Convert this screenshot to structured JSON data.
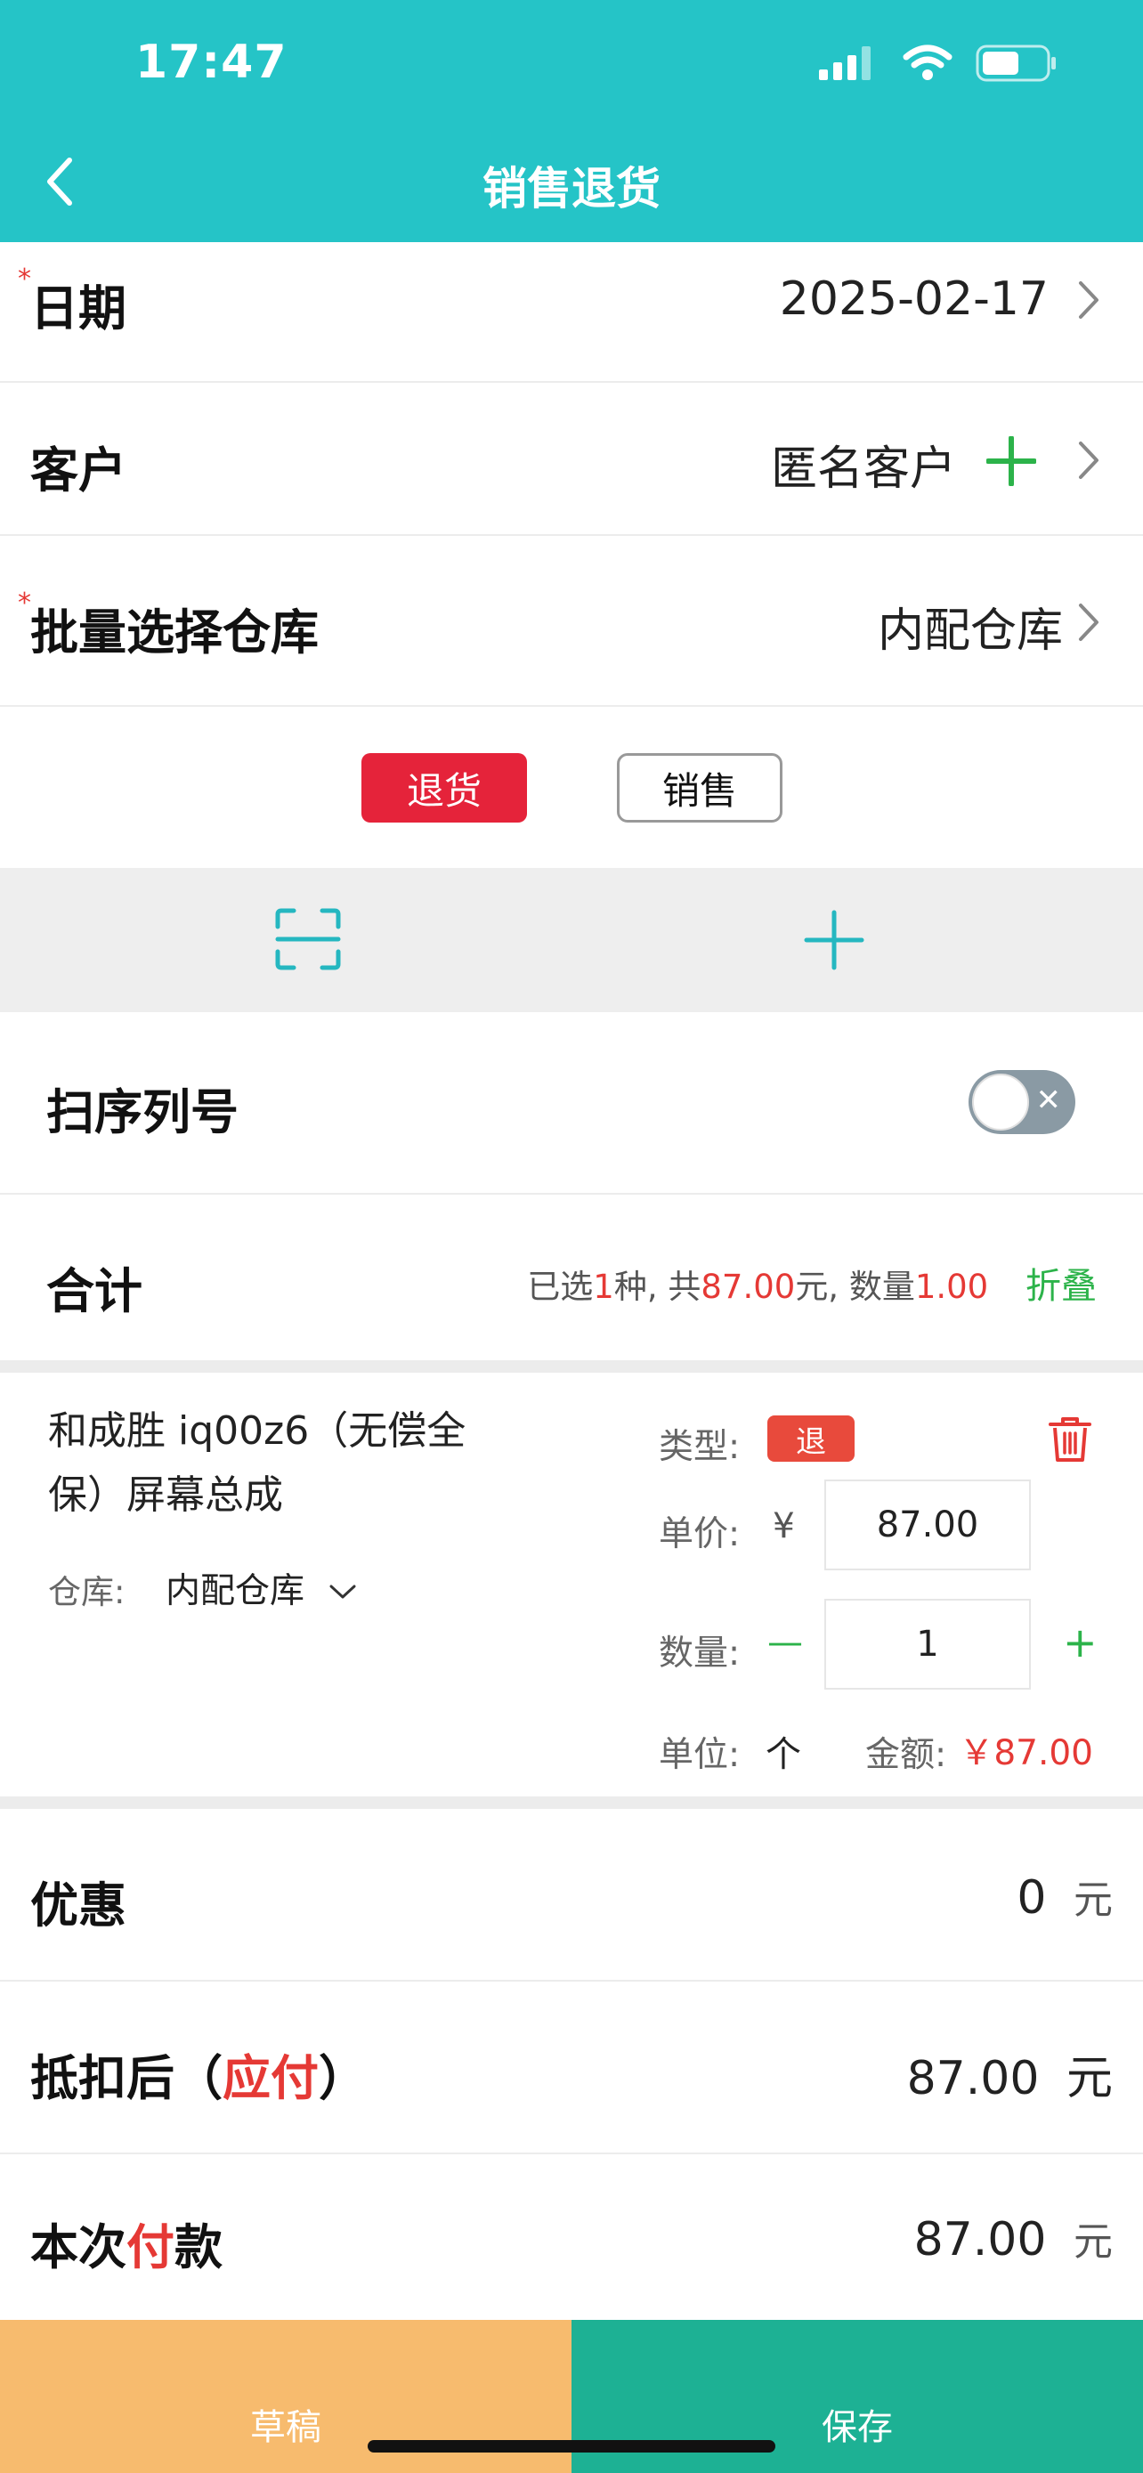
{
  "status_bar": {
    "time": "17:47"
  },
  "nav": {
    "title": "销售退货",
    "back_icon": "chevron-left-icon"
  },
  "form": {
    "date": {
      "label": "日期",
      "value": "2025-02-17",
      "required_mark": "*"
    },
    "customer": {
      "label": "客户",
      "value": "匿名客户"
    },
    "warehouse": {
      "label": "批量选择仓库",
      "value": "内配仓库",
      "required_mark": "*"
    }
  },
  "mode_buttons": {
    "return": "退货",
    "sale": "销售"
  },
  "toolbar": {
    "scan_icon": "scan-icon",
    "add_icon": "plus-icon"
  },
  "serial": {
    "label": "扫序列号",
    "toggle_on": false
  },
  "total": {
    "label": "合计",
    "text_selected": "已选",
    "kinds": "1",
    "text_kinds": "种, 共",
    "amount": "87.00",
    "text_amount_unit": "元, 数量",
    "quantity": "1.00",
    "collapse": "折叠"
  },
  "item": {
    "name": "和成胜 iq00z6（无偿全保）屏幕总成",
    "warehouse_label": "仓库:",
    "warehouse_value": "内配仓库",
    "type_label": "类型:",
    "type_value": "退",
    "price_label": "单价:",
    "currency": "¥",
    "price_value": "87.00",
    "qty_label": "数量:",
    "qty_value": "1",
    "minus": "—",
    "plus": "+",
    "unit_label": "单位:",
    "unit_value": "个",
    "amount_label": "金额:",
    "amount_value": "￥87.00"
  },
  "discount": {
    "label": "优惠",
    "value": "0",
    "unit": "元"
  },
  "payable": {
    "label_prefix": "抵扣后（",
    "label_highlight": "应付",
    "label_suffix": "）",
    "value": "87.00",
    "unit": "元"
  },
  "payment": {
    "label_prefix": "本次",
    "label_highlight": "付",
    "label_suffix": "款",
    "value": "87.00",
    "unit": "元"
  },
  "footer": {
    "draft": "草稿",
    "save": "保存"
  },
  "colors": {
    "header": "#25c4c7",
    "danger": "#e5233a",
    "green": "#2cb34a",
    "draft": "#f7bb6e",
    "save": "#1db194"
  }
}
